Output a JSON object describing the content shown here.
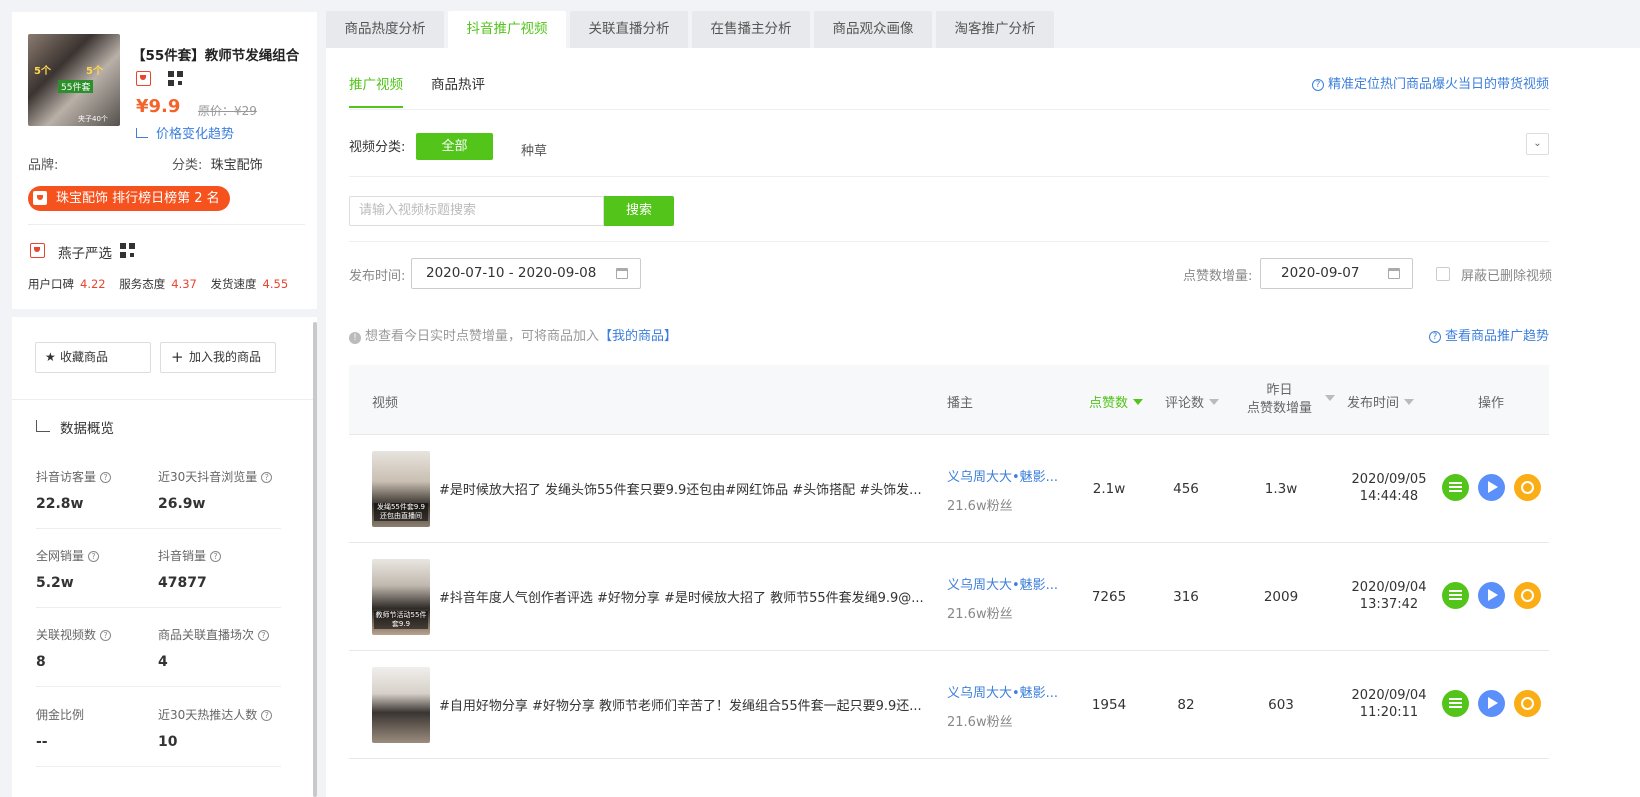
{
  "product": {
    "title": "【55件套】教师节发绳组合",
    "price": "¥9.9",
    "original_price": "原价：¥29",
    "price_trend": "价格变化趋势",
    "thumb_labels": [
      "5个",
      "5个",
      "55件套",
      "夹子40个"
    ],
    "brand_label": "品牌:",
    "category_label": "分类:",
    "category_value": "珠宝配饰",
    "rank_badge": "珠宝配饰 排行榜日榜第 2 名"
  },
  "shop": {
    "name": "燕子严选",
    "scores": [
      {
        "label": "用户口碑",
        "value": "4.22"
      },
      {
        "label": "服务态度",
        "value": "4.37"
      },
      {
        "label": "发货速度",
        "value": "4.55"
      }
    ]
  },
  "actions": {
    "favorite": "收藏商品",
    "add": "加入我的商品"
  },
  "overview": {
    "title": "数据概览",
    "stats": [
      {
        "label": "抖音访客量",
        "value": "22.8w"
      },
      {
        "label": "近30天抖音浏览量",
        "value": "26.9w"
      },
      {
        "label": "全网销量",
        "value": "5.2w"
      },
      {
        "label": "抖音销量",
        "value": "47877"
      },
      {
        "label": "关联视频数",
        "value": "8"
      },
      {
        "label": "商品关联直播场次",
        "value": "4"
      },
      {
        "label": "佣金比例",
        "value": "--"
      },
      {
        "label": "近30天热推达人数",
        "value": "10"
      }
    ]
  },
  "tabs": [
    "商品热度分析",
    "抖音推广视频",
    "关联直播分析",
    "在售播主分析",
    "商品观众画像",
    "淘客推广分析"
  ],
  "subtabs": [
    "推广视频",
    "商品热评"
  ],
  "hint_link": "精准定位热门商品爆火当日的带货视频",
  "filter": {
    "category_label": "视频分类:",
    "all": "全部",
    "seed": "种草"
  },
  "search": {
    "placeholder": "请输入视频标题搜索",
    "button": "搜索"
  },
  "date": {
    "publish_label": "发布时间:",
    "publish_range": "2020-07-10 - 2020-09-08",
    "likes_label": "点赞数增量:",
    "likes_date": "2020-09-07",
    "hide_deleted": "屏蔽已删除视频"
  },
  "tip": {
    "text": "想查看今日实时点赞增量，可将商品加入",
    "link": "【我的商品】"
  },
  "trend_link": "查看商品推广趋势",
  "table": {
    "headers": {
      "video": "视频",
      "host": "播主",
      "likes": "点赞数",
      "comments": "评论数",
      "yesterday_1": "昨日",
      "yesterday_2": "点赞数增量",
      "publish_time": "发布时间",
      "ops": "操作"
    },
    "rows": [
      {
        "title": "#是时候放大招了 发绳头饰55件套只要9.9还包由#网红饰品 #头饰搭配 #头饰发...",
        "thumb_caption": "发绳55件套9.9还包由直播间",
        "host": "义乌周大大•魅影...",
        "fans": "21.6w粉丝",
        "likes": "2.1w",
        "comments": "456",
        "yesterday": "1.3w",
        "date": "2020/09/05",
        "time": "14:44:48"
      },
      {
        "title": "#抖音年度人气创作者评选 #好物分享 #是时候放大招了 教师节55件套发绳9.9@...",
        "thumb_caption": "教师节活动55件套9.9",
        "host": "义乌周大大•魅影...",
        "fans": "21.6w粉丝",
        "likes": "7265",
        "comments": "316",
        "yesterday": "2009",
        "date": "2020/09/04",
        "time": "13:37:42"
      },
      {
        "title": "#自用好物分享 #好物分享 教师节老师们辛苦了！发绳组合55件套一起只要9.9还...",
        "thumb_caption": "",
        "host": "义乌周大大•魅影...",
        "fans": "21.6w粉丝",
        "likes": "1954",
        "comments": "82",
        "yesterday": "603",
        "date": "2020/09/04",
        "time": "11:20:11"
      }
    ]
  },
  "colors": {
    "accent_green": "#52c41a",
    "link_blue": "#3d7fdb",
    "price_orange": "#f5632a",
    "rank_red": "#f6521e"
  }
}
